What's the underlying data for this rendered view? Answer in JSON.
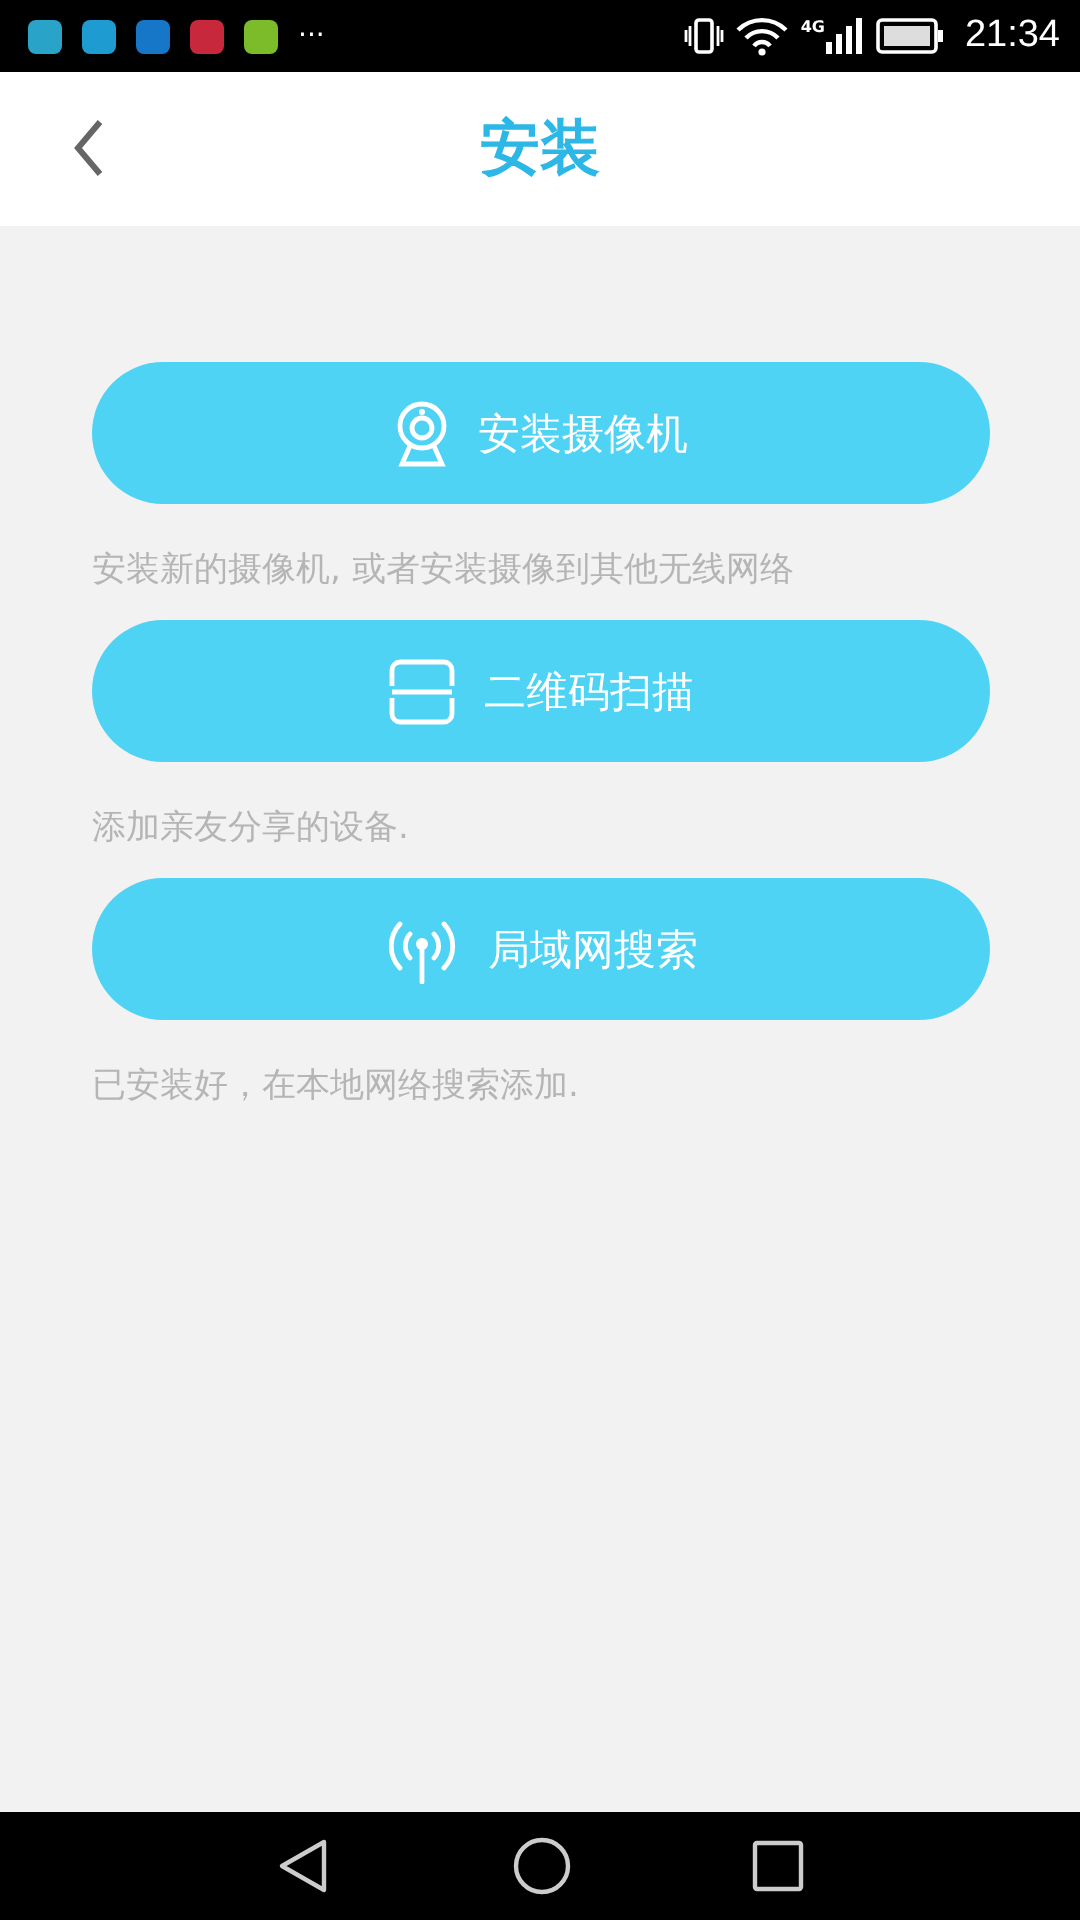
{
  "status_bar": {
    "apps": [
      {
        "color": "#2aa3c8"
      },
      {
        "color": "#1e9bd0"
      },
      {
        "color": "#1677c9"
      },
      {
        "color": "#c8283c"
      },
      {
        "color": "#7cbb2a"
      }
    ],
    "more": "···",
    "network": "4G",
    "time": "21:34"
  },
  "header": {
    "title": "安装"
  },
  "options": [
    {
      "kind": "camera",
      "label": "安装摄像机",
      "description": "安装新的摄像机, 或者安装摄像到其他无线网络"
    },
    {
      "kind": "qr",
      "label": "二维码扫描",
      "description": "添加亲友分享的设备."
    },
    {
      "kind": "antenna",
      "label": "局域网搜索",
      "description": "已安装好，在本地网络搜索添加."
    }
  ]
}
